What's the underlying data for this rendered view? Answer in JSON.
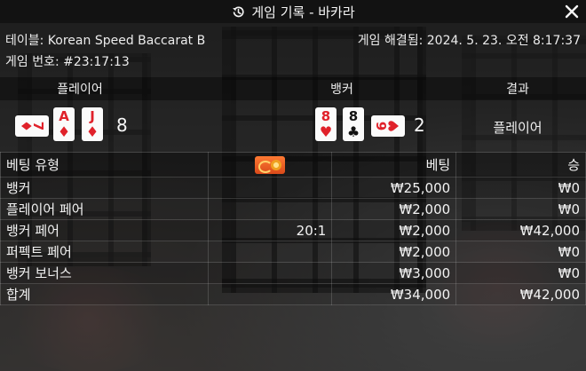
{
  "window": {
    "title": "게임 기록 - 바카라",
    "history_icon": "history-icon",
    "close_icon": "close-icon"
  },
  "info": {
    "table_label": "테이블: Korean Speed Baccarat B",
    "resolved_label": "게임 해결됨: 2024. 5. 23. 오전 8:17:37",
    "game_number_label": "게임 번호: #23:17:13"
  },
  "result": {
    "player_header": "플레이어",
    "banker_header": "뱅커",
    "result_header": "결과",
    "player_score": "8",
    "banker_score": "2",
    "outcome": "플레이어",
    "player_cards": [
      {
        "rank": "7",
        "suit": "♦",
        "color": "#e0212a",
        "orientation": "sideways"
      },
      {
        "rank": "A",
        "suit": "♦",
        "color": "#e0212a",
        "orientation": "upright"
      },
      {
        "rank": "J",
        "suit": "♦",
        "color": "#e0212a",
        "orientation": "upright"
      }
    ],
    "banker_cards": [
      {
        "rank": "8",
        "suit": "♥",
        "color": "#e0212a",
        "orientation": "upright"
      },
      {
        "rank": "8",
        "suit": "♣",
        "color": "#111111",
        "orientation": "upright"
      },
      {
        "rank": "6",
        "suit": "♥",
        "color": "#e0212a",
        "orientation": "sideways"
      }
    ]
  },
  "bets": {
    "headers": {
      "type": "베팅 유형",
      "odds_icon": "bonus-chip-icon",
      "bet": "베팅",
      "win": "승"
    },
    "rows": [
      {
        "type": "뱅커",
        "odds": "",
        "bet": "₩25,000",
        "win": "₩0"
      },
      {
        "type": "플레이어 페어",
        "odds": "",
        "bet": "₩2,000",
        "win": "₩0"
      },
      {
        "type": "뱅커 페어",
        "odds": "20:1",
        "bet": "₩2,000",
        "win": "₩42,000"
      },
      {
        "type": "퍼펙트 페어",
        "odds": "",
        "bet": "₩2,000",
        "win": "₩0"
      },
      {
        "type": "뱅커 보너스",
        "odds": "",
        "bet": "₩3,000",
        "win": "₩0"
      }
    ],
    "total": {
      "type": "합계",
      "odds": "",
      "bet": "₩34,000",
      "win": "₩42,000"
    }
  },
  "colors": {
    "red_suit": "#e0212a",
    "black_suit": "#111111",
    "chip_orange": "#ff7a33"
  }
}
